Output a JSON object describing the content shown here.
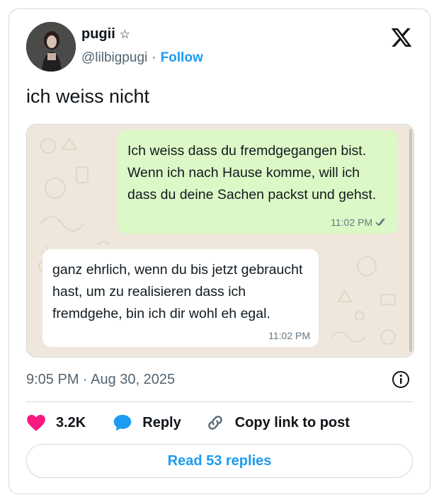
{
  "author": {
    "name": "pugii",
    "name_suffix": "☆",
    "handle": "@lilbigpugi",
    "separator": "·",
    "follow_label": "Follow"
  },
  "tweet": {
    "text": "ich weiss nicht",
    "timestamp": "9:05 PM · Aug 30, 2025"
  },
  "chat": {
    "outgoing": {
      "text": "Ich weiss dass du fremdgegangen bist. Wenn ich nach Hause komme, will ich dass du deine Sachen packst und gehst.",
      "time": "11:02 PM",
      "status_icon": "double-check-icon"
    },
    "incoming": {
      "text": "ganz ehrlich, wenn du bis jetzt gebraucht hast, um zu realisieren dass ich fremdgehe, bin ich dir wohl eh egal.",
      "time": "11:02 PM"
    }
  },
  "actions": {
    "likes": "3.2K",
    "reply_label": "Reply",
    "copy_label": "Copy link to post"
  },
  "read_replies_label": "Read 53 replies",
  "colors": {
    "accent": "#1d9bf0",
    "like": "#f91880",
    "outgoing_bubble": "#dcf8c6",
    "chat_background": "#efe7dc"
  }
}
